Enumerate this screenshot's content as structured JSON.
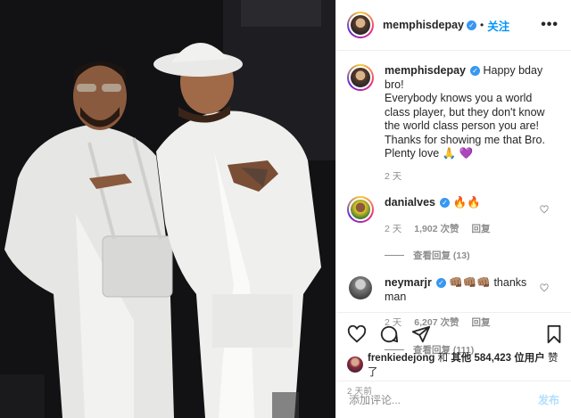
{
  "post": {
    "author": "memphisdepay",
    "follow_label": "关注",
    "more_icon": "more-dots-icon",
    "caption_lines": [
      "Happy bday bro!",
      "Everybody knows you a world class player, but they don't know the world class person you are!",
      "Thanks for showing me that Bro. Plenty love 🙏 💜"
    ],
    "caption_time": "2 天"
  },
  "comments": [
    {
      "user": "danialves",
      "text": "🔥🔥",
      "time": "2 天",
      "likes": "1,902 次赞",
      "reply": "回复",
      "view_replies": "查看回复 (13)"
    },
    {
      "user": "neymarjr",
      "text": "👊🏽👊🏽👊🏽 thanks man",
      "time": "2 天",
      "likes": "6,207 次赞",
      "reply": "回复",
      "view_replies": "查看回复 (111)"
    }
  ],
  "actions": {
    "icons": [
      "heart-icon",
      "comment-icon",
      "share-icon",
      "bookmark-icon"
    ],
    "liked_by_user": "frenkiedejong",
    "liked_by_and": "和",
    "liked_by_others": "其他 584,423 位用户",
    "liked_by_suffix": "赞了",
    "posted_ago": "2 天前",
    "add_comment_placeholder": "添加评论...",
    "post_label": "发布"
  },
  "colors": {
    "link_blue": "#0095f6",
    "verified_blue": "#3897f0",
    "muted": "#8e8e8e",
    "post_disabled": "#b2dffc"
  }
}
